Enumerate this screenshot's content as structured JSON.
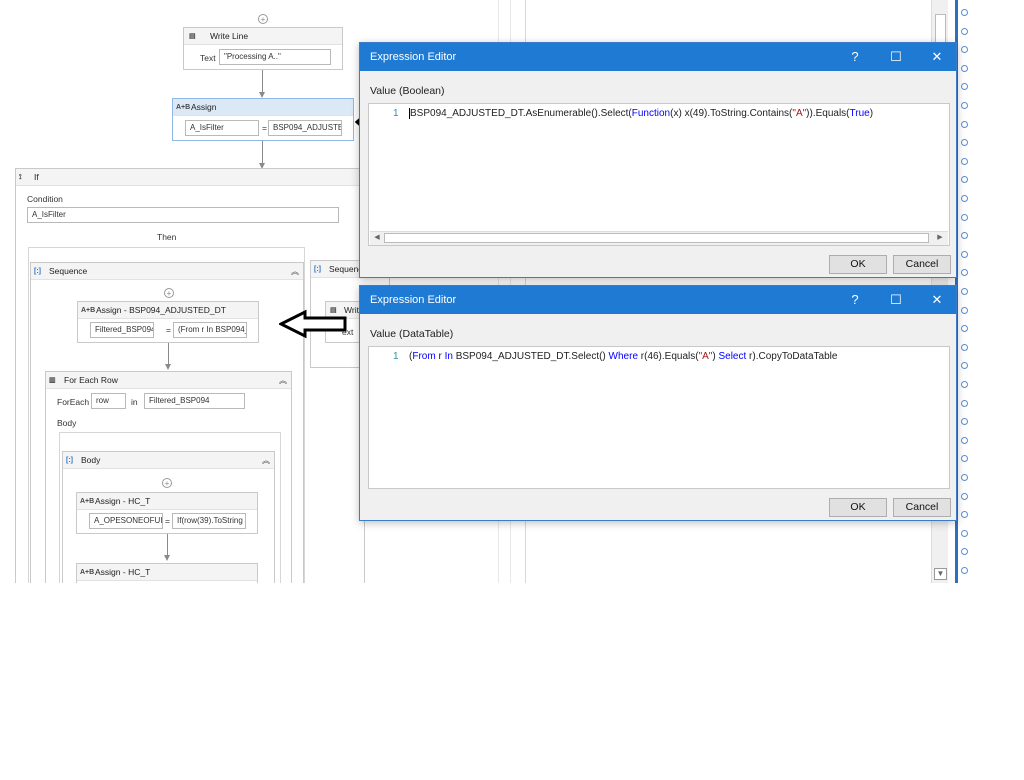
{
  "canvas": {
    "write_line": {
      "title": "Write Line",
      "text_label": "Text",
      "text_value": "\"Processing A..\""
    },
    "assign_top": {
      "title": "Assign",
      "to_value": "A_IsFilter",
      "equals": "=",
      "value": "BSP094_ADJUSTED_"
    },
    "if_block": {
      "title": "If",
      "condition_label": "Condition",
      "condition_value": "A_IsFilter",
      "then_label": "Then"
    },
    "sequence_left": {
      "title": "Sequence"
    },
    "sequence_right": {
      "title": "Sequenc",
      "write_partial": "Writ",
      "text_partial": "ext"
    },
    "assign_bsp": {
      "title": "Assign - BSP094_ADJUSTED_DT",
      "to_value": "Filtered_BSP094",
      "equals": "=",
      "value": "(From r In BSP094_"
    },
    "for_each": {
      "title": "For Each Row",
      "foreach_label": "ForEach",
      "item": "row",
      "in_label": "in",
      "collection": "Filtered_BSP094",
      "body_label": "Body"
    },
    "body": {
      "title": "Body"
    },
    "assign_hct1": {
      "title": "Assign - HC_T",
      "to_value": "A_OPESONEOFUID",
      "equals": "=",
      "value": "If(row(39).ToString"
    },
    "assign_hct2": {
      "title": "Assign - HC_T"
    }
  },
  "dialog_top": {
    "title": "Expression Editor",
    "help": "?",
    "maximize": "☐",
    "close": "✕",
    "value_label": "Value (Boolean)",
    "line_number": "1",
    "code_parts": [
      "BSP094_ADJUSTED_DT.AsEnumerable().Select(",
      "Function",
      "(x) x(49).ToString.Contains(",
      "\"A\"",
      ")).Equals(",
      "True",
      ")"
    ],
    "ok": "OK",
    "cancel": "Cancel"
  },
  "dialog_bottom": {
    "title": "Expression Editor",
    "help": "?",
    "maximize": "☐",
    "close": "✕",
    "value_label": "Value (DataTable)",
    "line_number": "1",
    "code_parts": [
      "(",
      "From",
      " r ",
      "In",
      " BSP094_ADJUSTED_DT.Select() ",
      "Where",
      " r(46).Equals(",
      "\"A\"",
      ") ",
      "Select",
      " r).CopyToDataTable"
    ],
    "ok": "OK",
    "cancel": "Cancel"
  },
  "colors": {
    "title_bar": "#1f7ad4",
    "keyword": "#0000ff",
    "string": "#a31515",
    "line_number": "#2b91af"
  },
  "icons": [
    "write-line-icon",
    "assign-icon",
    "if-icon",
    "sequence-icon",
    "for-each-icon",
    "add-activity-icon",
    "collapse-icon",
    "annotation-arrow-icon"
  ]
}
